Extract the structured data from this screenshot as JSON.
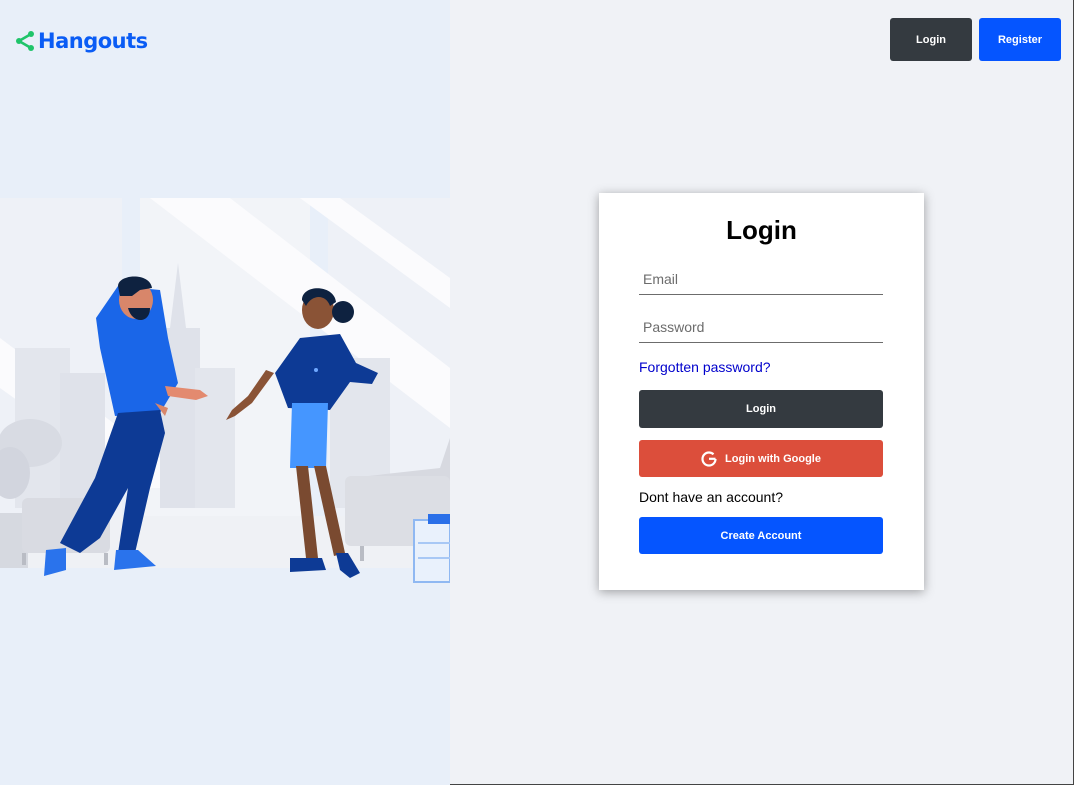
{
  "brand": {
    "name": "Hangouts",
    "logo_icon": "share-icon",
    "color": "#0a5cf5"
  },
  "header": {
    "login_label": "Login",
    "register_label": "Register"
  },
  "login_card": {
    "title": "Login",
    "email_placeholder": "Email",
    "password_placeholder": "Password",
    "forgot_label": "Forgotten password?",
    "login_button": "Login",
    "google_button": "Login with Google",
    "no_account_text": "Dont have an account?",
    "create_account_button": "Create Account"
  },
  "colors": {
    "dark_button": "#343a40",
    "primary_button": "#0555ff",
    "google_button": "#dc4e3b",
    "left_panel_bg": "#e8eff9",
    "right_panel_bg": "#f0f2f6"
  }
}
